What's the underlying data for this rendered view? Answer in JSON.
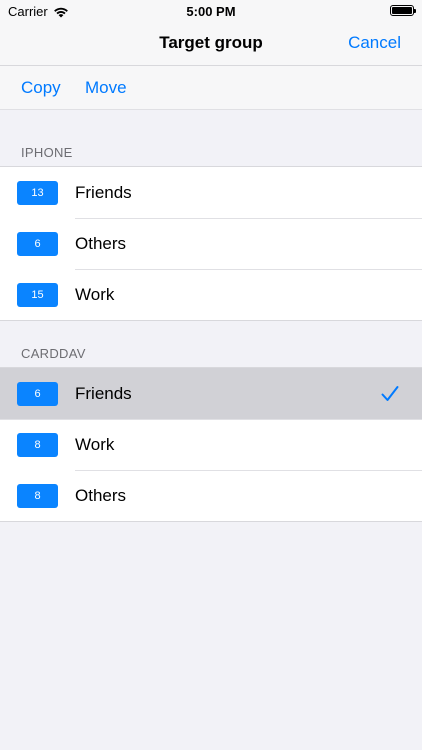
{
  "status_bar": {
    "carrier": "Carrier",
    "time": "5:00 PM",
    "icons": [
      "wifi-icon",
      "battery-icon"
    ]
  },
  "nav": {
    "title": "Target group",
    "cancel_label": "Cancel"
  },
  "toolbar": {
    "copy_label": "Copy",
    "move_label": "Move"
  },
  "sections": [
    {
      "header": "IPHONE",
      "items": [
        {
          "count": "13",
          "label": "Friends"
        },
        {
          "count": "6",
          "label": "Others"
        },
        {
          "count": "15",
          "label": "Work"
        }
      ]
    },
    {
      "header": "CARDDAV",
      "items": [
        {
          "count": "6",
          "label": "Friends",
          "selected": true
        },
        {
          "count": "8",
          "label": "Work"
        },
        {
          "count": "8",
          "label": "Others"
        }
      ]
    }
  ],
  "colors": {
    "accent": "#007aff",
    "badge": "#0a84ff",
    "selected_row": "#d1d1d6",
    "background": "#f2f2f7"
  }
}
